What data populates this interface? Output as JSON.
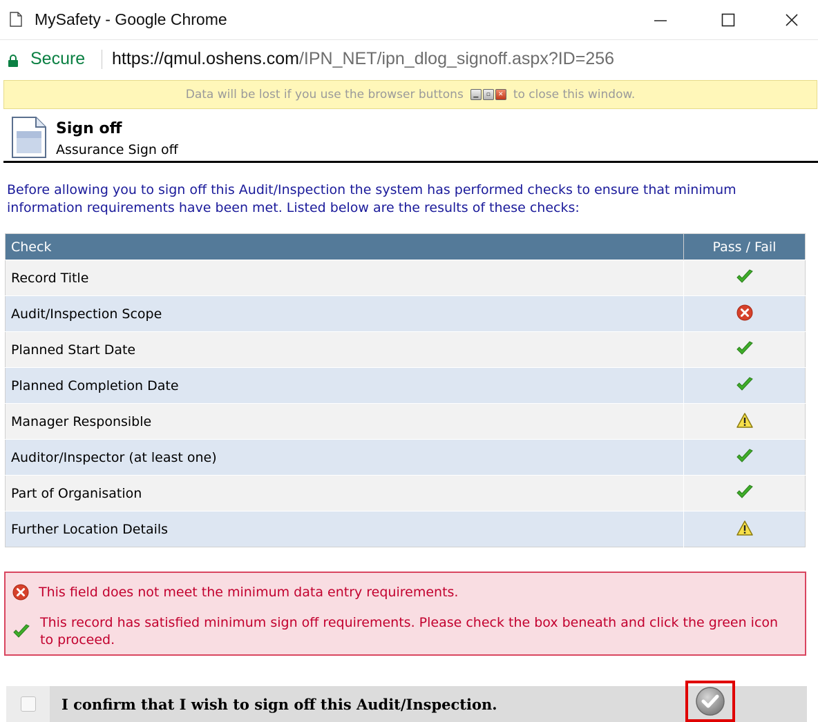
{
  "window": {
    "title": "MySafety - Google Chrome"
  },
  "address": {
    "secure_label": "Secure",
    "url_host": "https://qmul.oshens.com",
    "url_path": "/IPN_NET/ipn_dlog_signoff.aspx?ID=256"
  },
  "warning": {
    "text_before": "Data will be lost if you use the browser buttons",
    "text_after": "to close this window."
  },
  "header": {
    "title": "Sign off",
    "subtitle": "Assurance Sign off"
  },
  "intro": "Before allowing you to sign off this Audit/Inspection the system has performed checks to ensure that minimum information requirements have been met. Listed below are the results of these checks:",
  "table": {
    "col_check": "Check",
    "col_result": "Pass / Fail",
    "rows": [
      {
        "label": "Record Title",
        "status": "pass"
      },
      {
        "label": "Audit/Inspection Scope",
        "status": "fail"
      },
      {
        "label": "Planned Start Date",
        "status": "pass"
      },
      {
        "label": "Planned Completion Date",
        "status": "pass"
      },
      {
        "label": "Manager Responsible",
        "status": "warning"
      },
      {
        "label": "Auditor/Inspector (at least one)",
        "status": "pass"
      },
      {
        "label": "Part of Organisation",
        "status": "pass"
      },
      {
        "label": "Further Location Details",
        "status": "warning"
      }
    ]
  },
  "legend": {
    "fail_text": "This field does not meet the minimum data entry requirements.",
    "pass_text": "This record has satisfied minimum sign off requirements. Please check the box beneath and click the green icon to proceed."
  },
  "confirm": {
    "label": "I confirm that I wish to sign off this Audit/Inspection.",
    "checked": false
  },
  "icons": {
    "pass": "green-check-icon",
    "fail": "red-x-circle-icon",
    "warning": "yellow-warning-triangle-icon"
  },
  "colors": {
    "table_header": "#547a99",
    "row_odd": "#f2f2f2",
    "row_even": "#dde6f2",
    "legend_bg": "#f9dde2",
    "legend_text": "#c2002e",
    "intro_text": "#1a1a9a",
    "secure_green": "#0b8043",
    "highlight_red": "#e00000"
  }
}
